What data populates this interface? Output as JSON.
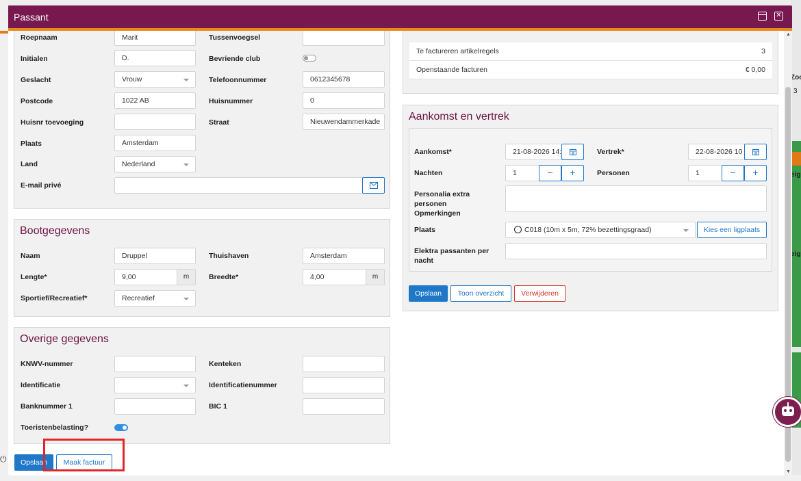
{
  "modal": {
    "title": "Passant"
  },
  "personal": {
    "fields": [
      {
        "label": "Roepnaam",
        "value": "Marit"
      },
      {
        "label": "Tussenvoegsel",
        "value": ""
      },
      {
        "label": "Initialen",
        "value": "D."
      },
      {
        "label": "Bevriende club",
        "value": ""
      },
      {
        "label": "Geslacht",
        "value": "Vrouw"
      },
      {
        "label": "Telefoonnummer",
        "value": "0612345678"
      },
      {
        "label": "Postcode",
        "value": "1022 AB"
      },
      {
        "label": "Huisnummer",
        "value": "0"
      },
      {
        "label": "Huisnr toevoeging",
        "value": ""
      },
      {
        "label": "Straat",
        "value": "Nieuwendammerkade"
      },
      {
        "label": "Plaats",
        "value": "Amsterdam"
      },
      {
        "label": "Land",
        "value": "Nederland"
      },
      {
        "label": "E-mail privé",
        "value": ""
      }
    ],
    "bevriende_club_on": false
  },
  "boat": {
    "title": "Bootgegevens",
    "naam_label": "Naam",
    "naam": "Druppel",
    "thuishaven_label": "Thuishaven",
    "thuishaven": "Amsterdam",
    "lengte_label": "Lengte*",
    "lengte": "9,00",
    "lengte_unit": "m",
    "breedte_label": "Breedte*",
    "breedte": "4,00",
    "breedte_unit": "m",
    "sport_label": "Sportief/Recreatief*",
    "sport": "Recreatief"
  },
  "other": {
    "title": "Overige gegevens",
    "knwv_label": "KNWV-nummer",
    "knwv": "",
    "kenteken_label": "Kenteken",
    "kenteken": "",
    "ident_label": "Identificatie",
    "ident": "",
    "identnr_label": "Identificatienummer",
    "identnr": "",
    "bank_label": "Banknummer 1",
    "bank": "",
    "bic_label": "BIC 1",
    "bic": "",
    "toerist_label": "Toeristenbelasting?",
    "toerist_on": true
  },
  "footer": {
    "save": "Opslaan",
    "invoice": "Maak factuur"
  },
  "summary": [
    {
      "label": "Te factureren artikelregels",
      "value": "3"
    },
    {
      "label": "Openstaande facturen",
      "value": "€ 0,00"
    }
  ],
  "stay": {
    "title": "Aankomst en vertrek",
    "aankomst_label": "Aankomst*",
    "aankomst": "21-08-2026 14:",
    "vertrek_label": "Vertrek*",
    "vertrek": "22-08-2026 10",
    "nachten_label": "Nachten",
    "nachten": "1",
    "personen_label": "Personen",
    "personen": "1",
    "personalia_label": "Personalia extra personen Opmerkingen",
    "personalia": "",
    "plaats_label": "Plaats",
    "plaats": "C018 (10m x 5m, 72% bezettingsgraad)",
    "kies_label": "Kies een ligplaats",
    "elektra_label": "Elektra passanten per nacht",
    "elektra": "",
    "save": "Opslaan",
    "overview": "Toon overzicht",
    "delete": "Verwijderen"
  },
  "background": {
    "right_top": "Zoo",
    "right_num": "3",
    "right_label": "eig"
  }
}
